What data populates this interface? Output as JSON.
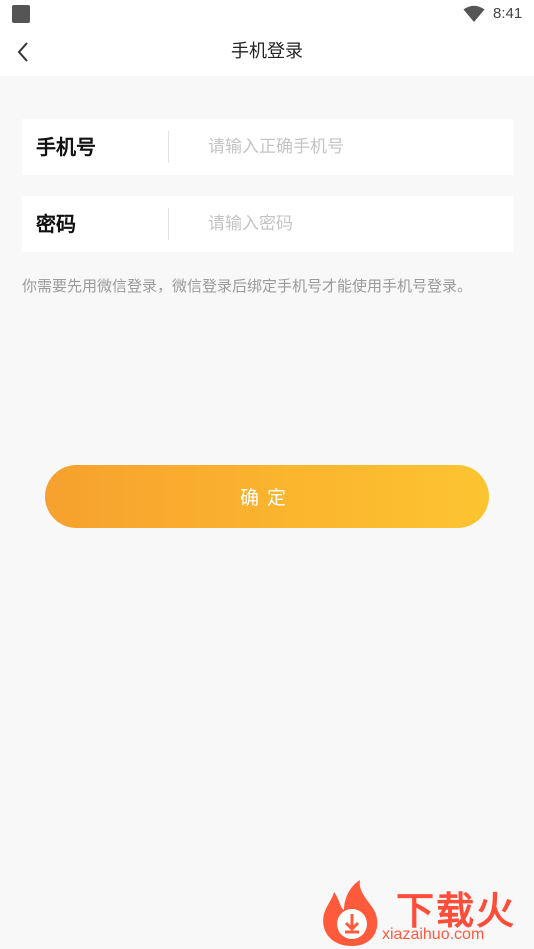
{
  "status_bar": {
    "time": "8:41",
    "wifi_icon": "wifi-icon"
  },
  "nav": {
    "back_icon": "chevron-left-icon",
    "title": "手机登录"
  },
  "form": {
    "phone": {
      "label": "手机号",
      "placeholder": "请输入正确手机号",
      "value": ""
    },
    "password": {
      "label": "密码",
      "placeholder": "请输入密码",
      "value": ""
    }
  },
  "hint": "你需要先用微信登录，微信登录后绑定手机号才能使用手机号登录。",
  "confirm_button": "确定",
  "watermark": {
    "brand": "下载火",
    "domain": "xiazaihuo.com"
  },
  "colors": {
    "button_gradient_start": "#f6a12e",
    "button_gradient_end": "#fcc430",
    "watermark_red": "#ff4d3a"
  }
}
